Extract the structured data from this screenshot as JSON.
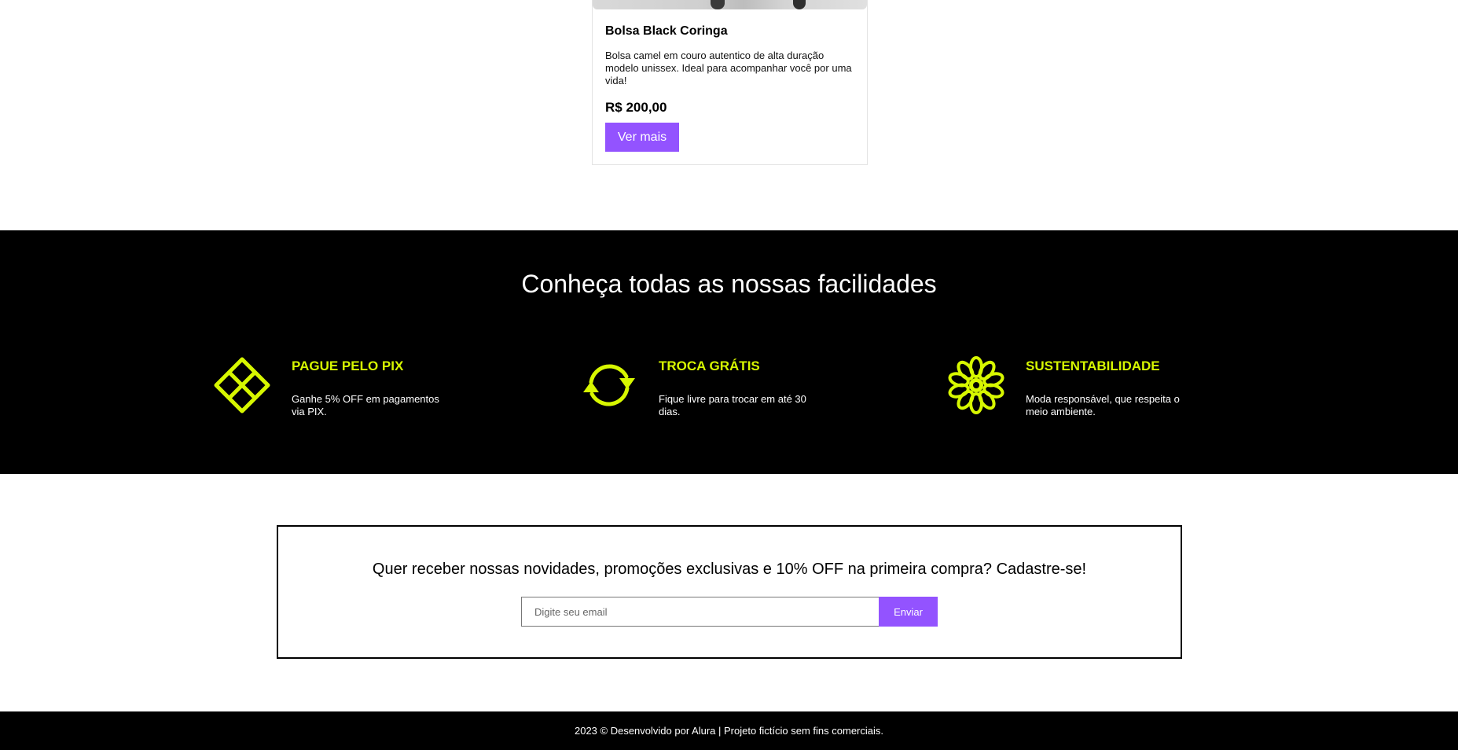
{
  "product": {
    "name": "Bolsa Black Coringa",
    "description": "Bolsa camel em couro autentico de alta duração modelo unissex. Ideal para acompanhar você por uma vida!",
    "price": "R$ 200,00",
    "button_label": "Ver mais"
  },
  "features": {
    "title": "Conheça todas as nossas facilidades",
    "accent_color": "#d7f700",
    "items": [
      {
        "icon": "pix-diamond-icon",
        "title": "PAGUE PELO PIX",
        "text": "Ganhe 5% OFF em pagamentos via PIX."
      },
      {
        "icon": "exchange-arrows-icon",
        "title": "TROCA GRÁTIS",
        "text": "Fique livre para trocar em até 30 dias."
      },
      {
        "icon": "flower-icon",
        "title": "SUSTENTABILIDADE",
        "text": "Moda responsável, que respeita o meio ambiente."
      }
    ]
  },
  "newsletter": {
    "text": "Quer receber nossas novidades, promoções exclusivas e 10% OFF na primeira compra?",
    "cta": "Cadastre-se!",
    "input_placeholder": "Digite seu email",
    "button_label": "Enviar"
  },
  "footer": {
    "text": "2023 © Desenvolvido por Alura | Projeto fictício sem fins comerciais."
  },
  "colors": {
    "primary_button": "#9353ff",
    "accent": "#d7f700",
    "dark_background": "#000000"
  }
}
